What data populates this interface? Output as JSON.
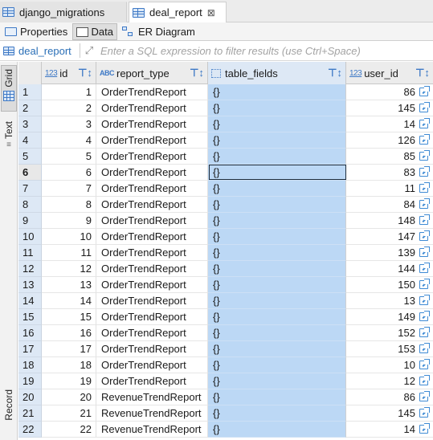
{
  "editor_tabs": [
    {
      "label": "django_migrations"
    },
    {
      "label": "deal_report",
      "close": "⊠"
    }
  ],
  "sub_tabs": {
    "properties": "Properties",
    "data": "Data",
    "er_diagram": "ER Diagram"
  },
  "filter": {
    "table_name": "deal_report",
    "placeholder": "Enter a SQL expression to filter results (use Ctrl+Space)"
  },
  "side_panel": {
    "grid": "Grid",
    "text": "Text",
    "record": "Record"
  },
  "grid": {
    "columns": [
      {
        "type_tag": "123",
        "label": "id"
      },
      {
        "type_tag": "ABC",
        "label": "report_type"
      },
      {
        "type_tag": "",
        "label": "table_fields"
      },
      {
        "type_tag": "123",
        "label": "user_id"
      }
    ],
    "current_row": 6,
    "rows": [
      {
        "rn": "1",
        "id": "1",
        "report_type": "OrderTrendReport",
        "table_fields": "{}",
        "user_id": "86"
      },
      {
        "rn": "2",
        "id": "2",
        "report_type": "OrderTrendReport",
        "table_fields": "{}",
        "user_id": "145"
      },
      {
        "rn": "3",
        "id": "3",
        "report_type": "OrderTrendReport",
        "table_fields": "{}",
        "user_id": "14"
      },
      {
        "rn": "4",
        "id": "4",
        "report_type": "OrderTrendReport",
        "table_fields": "{}",
        "user_id": "126"
      },
      {
        "rn": "5",
        "id": "5",
        "report_type": "OrderTrendReport",
        "table_fields": "{}",
        "user_id": "85"
      },
      {
        "rn": "6",
        "id": "6",
        "report_type": "OrderTrendReport",
        "table_fields": "{}",
        "user_id": "83"
      },
      {
        "rn": "7",
        "id": "7",
        "report_type": "OrderTrendReport",
        "table_fields": "{}",
        "user_id": "11"
      },
      {
        "rn": "8",
        "id": "8",
        "report_type": "OrderTrendReport",
        "table_fields": "{}",
        "user_id": "84"
      },
      {
        "rn": "9",
        "id": "9",
        "report_type": "OrderTrendReport",
        "table_fields": "{}",
        "user_id": "148"
      },
      {
        "rn": "10",
        "id": "10",
        "report_type": "OrderTrendReport",
        "table_fields": "{}",
        "user_id": "147"
      },
      {
        "rn": "11",
        "id": "11",
        "report_type": "OrderTrendReport",
        "table_fields": "{}",
        "user_id": "139"
      },
      {
        "rn": "12",
        "id": "12",
        "report_type": "OrderTrendReport",
        "table_fields": "{}",
        "user_id": "144"
      },
      {
        "rn": "13",
        "id": "13",
        "report_type": "OrderTrendReport",
        "table_fields": "{}",
        "user_id": "150"
      },
      {
        "rn": "14",
        "id": "14",
        "report_type": "OrderTrendReport",
        "table_fields": "{}",
        "user_id": "13"
      },
      {
        "rn": "15",
        "id": "15",
        "report_type": "OrderTrendReport",
        "table_fields": "{}",
        "user_id": "149"
      },
      {
        "rn": "16",
        "id": "16",
        "report_type": "OrderTrendReport",
        "table_fields": "{}",
        "user_id": "152"
      },
      {
        "rn": "17",
        "id": "17",
        "report_type": "OrderTrendReport",
        "table_fields": "{}",
        "user_id": "153"
      },
      {
        "rn": "18",
        "id": "18",
        "report_type": "OrderTrendReport",
        "table_fields": "{}",
        "user_id": "10"
      },
      {
        "rn": "19",
        "id": "19",
        "report_type": "OrderTrendReport",
        "table_fields": "{}",
        "user_id": "12"
      },
      {
        "rn": "20",
        "id": "20",
        "report_type": "RevenueTrendReport",
        "table_fields": "{}",
        "user_id": "86"
      },
      {
        "rn": "21",
        "id": "21",
        "report_type": "RevenueTrendReport",
        "table_fields": "{}",
        "user_id": "145"
      },
      {
        "rn": "22",
        "id": "22",
        "report_type": "RevenueTrendReport",
        "table_fields": "{}",
        "user_id": "14"
      }
    ]
  },
  "colors": {
    "accent": "#3e79c6",
    "selected_column": "#bcd8f5",
    "row_header": "#dde8f5"
  }
}
